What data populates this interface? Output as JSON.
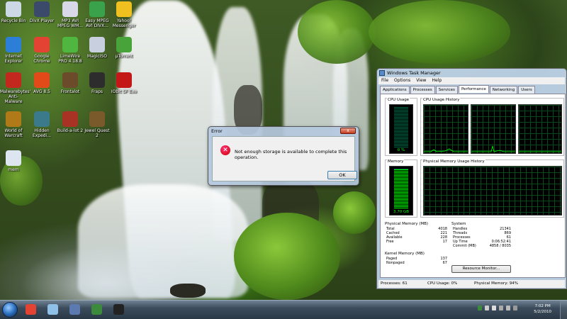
{
  "desktop": {
    "icons": [
      {
        "label": "Recycle Bin",
        "name": "recycle-bin",
        "color": "#cdd8e6"
      },
      {
        "label": "DivX Player",
        "name": "divx-player",
        "color": "#3b4a6b"
      },
      {
        "label": "MP3 AVI MPEG WM...",
        "name": "mp3-avi-converter",
        "color": "#d8d8e8"
      },
      {
        "label": "Easy MPEG AVI DIVX...",
        "name": "easy-mpeg",
        "color": "#3aa24a"
      },
      {
        "label": "Yahoo! Messenger",
        "name": "yahoo-messenger",
        "color": "#f0c020"
      },
      {
        "label": "Internet Explorer",
        "name": "internet-explorer",
        "color": "#2b7fd6"
      },
      {
        "label": "Google Chrome",
        "name": "google-chrome",
        "color": "#e24333"
      },
      {
        "label": "LimeWire PRO 4.18.8",
        "name": "limewire",
        "color": "#4fb640"
      },
      {
        "label": "MagicISO",
        "name": "magiciso",
        "color": "#c8d0e0"
      },
      {
        "label": "µTorrent",
        "name": "utorrent",
        "color": "#47a33a"
      },
      {
        "label": "Malwarebytes' Anti-Malware",
        "name": "malwarebytes",
        "color": "#c2281e"
      },
      {
        "label": "AVG 8.5",
        "name": "avg",
        "color": "#e24a1a"
      },
      {
        "label": "Frontalot",
        "name": "frontalot",
        "color": "#6b4b2a"
      },
      {
        "label": "Fraps",
        "name": "fraps",
        "color": "#2d2d2d"
      },
      {
        "label": "IObit SF Exe",
        "name": "iobit",
        "color": "#c41818"
      },
      {
        "label": "World of Warcraft",
        "name": "world-of-warcraft",
        "color": "#b07a18"
      },
      {
        "label": "Hidden Expedi...",
        "name": "hidden-expedition",
        "color": "#3a7a8a"
      },
      {
        "label": "Build-a-lot 2",
        "name": "build-a-lot",
        "color": "#a83224"
      },
      {
        "label": "Jewel Quest 2",
        "name": "jewel-quest",
        "color": "#7a5a2a"
      },
      {
        "label": "mem",
        "name": "mem",
        "color": "#dde6f0"
      }
    ]
  },
  "error_dialog": {
    "title": "Error",
    "close_label": "x",
    "error_icon_glyph": "✕",
    "message": "Not enough storage is available to complete this operation.",
    "ok_label": "OK"
  },
  "task_manager": {
    "title": "Windows Task Manager",
    "menu": [
      "File",
      "Options",
      "View",
      "Help"
    ],
    "tabs": [
      "Applications",
      "Processes",
      "Services",
      "Performance",
      "Networking",
      "Users"
    ],
    "active_tab": "Performance",
    "cpu_usage_label": "CPU Usage",
    "cpu_usage_value": "0 %",
    "cpu_usage_fraction": 0.0,
    "cpu_history_label": "CPU Usage History",
    "memory_label": "Memory",
    "memory_value": "3.70 GB",
    "memory_fraction": 0.94,
    "memory_history_label": "Physical Memory Usage History",
    "physical_memory": {
      "heading": "Physical Memory (MB)",
      "rows": [
        [
          "Total",
          "4018"
        ],
        [
          "Cached",
          "221"
        ],
        [
          "Available",
          "228"
        ],
        [
          "Free",
          "17"
        ]
      ]
    },
    "kernel_memory": {
      "heading": "Kernel Memory (MB)",
      "rows": [
        [
          "Paged",
          "137"
        ],
        [
          "Nonpaged",
          "67"
        ]
      ]
    },
    "system": {
      "heading": "System",
      "rows": [
        [
          "Handles",
          "21341"
        ],
        [
          "Threads",
          "869"
        ],
        [
          "Processes",
          "61"
        ],
        [
          "Up Time",
          "0:06:52:41"
        ],
        [
          "Commit (MB)",
          "4858 / 8035"
        ]
      ]
    },
    "resource_monitor_label": "Resource Monitor...",
    "status": {
      "processes": "Processes: 61",
      "cpu": "CPU Usage: 0%",
      "memory": "Physical Memory: 94%"
    }
  },
  "taskbar": {
    "buttons": [
      {
        "name": "chrome-taskbar-button",
        "color": "#e24333"
      },
      {
        "name": "explorer-taskbar-button",
        "color": "#8fc0e8"
      },
      {
        "name": "computer-taskbar-button",
        "color": "#5a7ab0"
      },
      {
        "name": "task-manager-taskbar-button",
        "color": "#3c8a3c"
      },
      {
        "name": "game-taskbar-button",
        "color": "#222222"
      }
    ],
    "clock_time": "7:02 PM",
    "clock_date": "5/2/2010"
  }
}
